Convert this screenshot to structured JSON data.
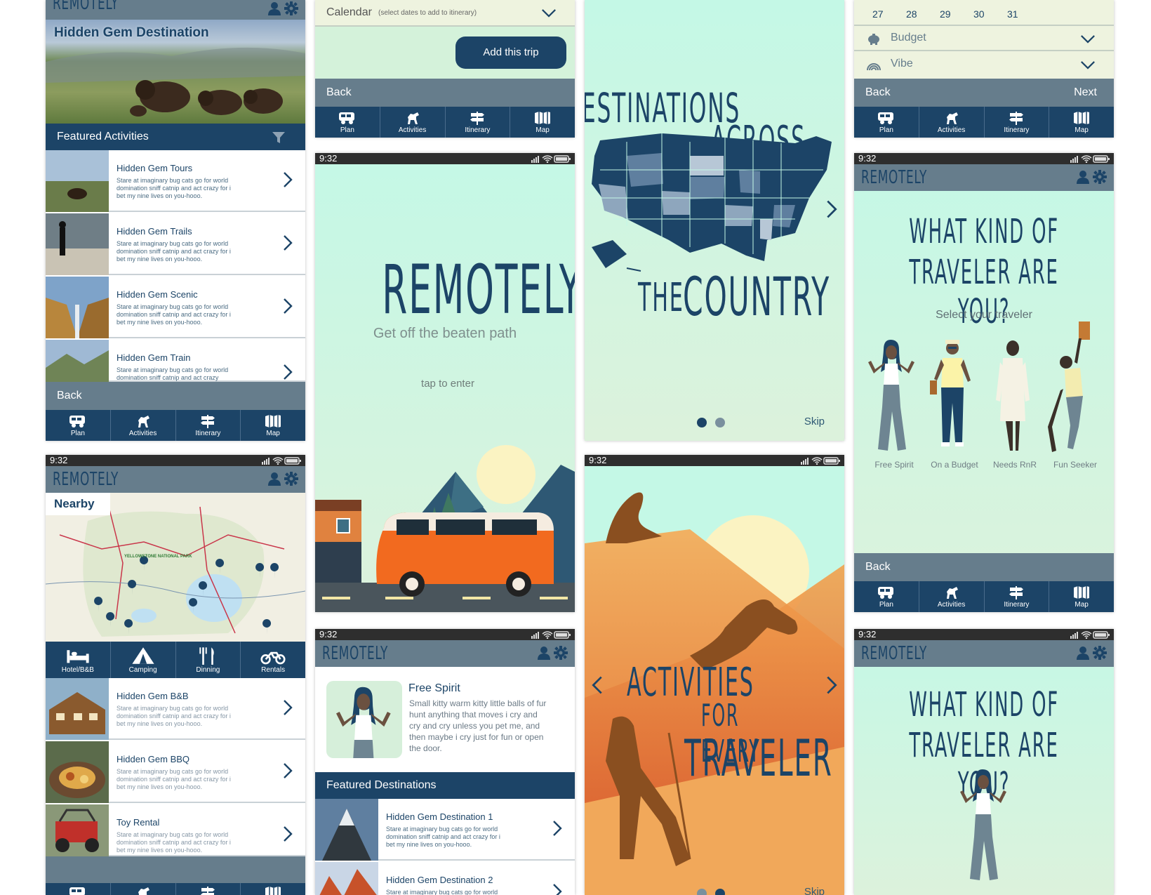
{
  "brand": "REMOTELY",
  "status": {
    "time": "9:32"
  },
  "nav": {
    "plan": "Plan",
    "activities": "Activities",
    "itinerary": "Itinerary",
    "map": "Map"
  },
  "common": {
    "back": "Back",
    "next": "Next",
    "skip": "Skip"
  },
  "screen1": {
    "hero_title": "Hidden Gem Destination",
    "section": "Featured Activities",
    "rows": [
      {
        "title": "Hidden Gem Tours",
        "desc": "Stare at imaginary bug cats go for world domination sniff catnip and act crazy for i bet my nine lives on you-hooo."
      },
      {
        "title": "Hidden Gem Trails",
        "desc": "Stare at imaginary bug cats go for world domination sniff catnip and act crazy for i bet my nine lives on you-hooo."
      },
      {
        "title": "Hidden Gem Scenic",
        "desc": "Stare at imaginary bug cats go for world domination sniff catnip and act crazy for i bet my nine lives on you-hooo."
      },
      {
        "title": "Hidden Gem Train",
        "desc": "Stare at imaginary bug cats go for world domination sniff catnip and act crazy"
      }
    ]
  },
  "screen2": {
    "nearby": "Nearby",
    "map_label": "YELLOWSTONE NATIONAL PARK",
    "categories": [
      "Hotel/B&B",
      "Camping",
      "Dinning",
      "Rentals"
    ],
    "rows": [
      {
        "title": "Hidden Gem B&B",
        "desc": "Stare at imaginary bug cats go for world domination sniff catnip and act crazy for i bet my nine lives on you-hooo."
      },
      {
        "title": "Hidden Gem BBQ",
        "desc": "Stare at imaginary bug cats go for world domination sniff catnip and act crazy for i bet my nine lives on you-hooo."
      },
      {
        "title": "Toy Rental",
        "desc": "Stare at imaginary bug cats go for world domination sniff catnip and act crazy for i bet my nine lives on you-hooo."
      }
    ]
  },
  "screen3": {
    "calendar_label": "Calendar",
    "calendar_hint": "(select dates to add to itinerary)",
    "add_button": "Add this trip"
  },
  "screen4": {
    "title": "REMOTELY",
    "tagline": "Get off the beaten path",
    "enter": "tap to enter"
  },
  "screen5": {
    "traveler_name": "Free Spirit",
    "traveler_desc": "Small kitty warm kitty little balls of fur hunt anything that moves i cry and cry and cry unless you pet me, and then maybe i cry just for fun or open the door.",
    "section": "Featured Destinations",
    "rows": [
      {
        "title": "Hidden Gem Destination 1",
        "desc": "Stare at imaginary bug cats go for world domination sniff catnip and act crazy for i bet my nine lives on you-hooo."
      },
      {
        "title": "Hidden Gem Destination 2",
        "desc": "Stare at imaginary bug cats go for world domination sniff catnip and act crazy"
      }
    ]
  },
  "screen6": {
    "line1": "DESTINATIONS",
    "line2": "ACROSS",
    "line3": "THE",
    "line4": "COUNTRY",
    "skip": "Skip"
  },
  "screen7": {
    "line1": "ACTIVITIES",
    "line2": "FOR EVERY",
    "line3": "TRAVELER",
    "skip": "Skip"
  },
  "screen8": {
    "dates": [
      "27",
      "28",
      "29",
      "30",
      "31"
    ],
    "budget": "Budget",
    "vibe": "Vibe"
  },
  "screen9": {
    "q1": "WHAT KIND OF",
    "q2": "TRAVELER ARE YOU?",
    "select": "Select your traveler",
    "types": [
      "Free Spirit",
      "On a Budget",
      "Needs RnR",
      "Fun Seeker"
    ]
  },
  "screen10": {
    "q1": "WHAT KIND OF",
    "q2": "TRAVELER ARE YOU?"
  },
  "colors": {
    "navy": "#1c4467",
    "slate": "#667d8c",
    "mint": "#c4f8e6",
    "orange": "#e0682a"
  }
}
